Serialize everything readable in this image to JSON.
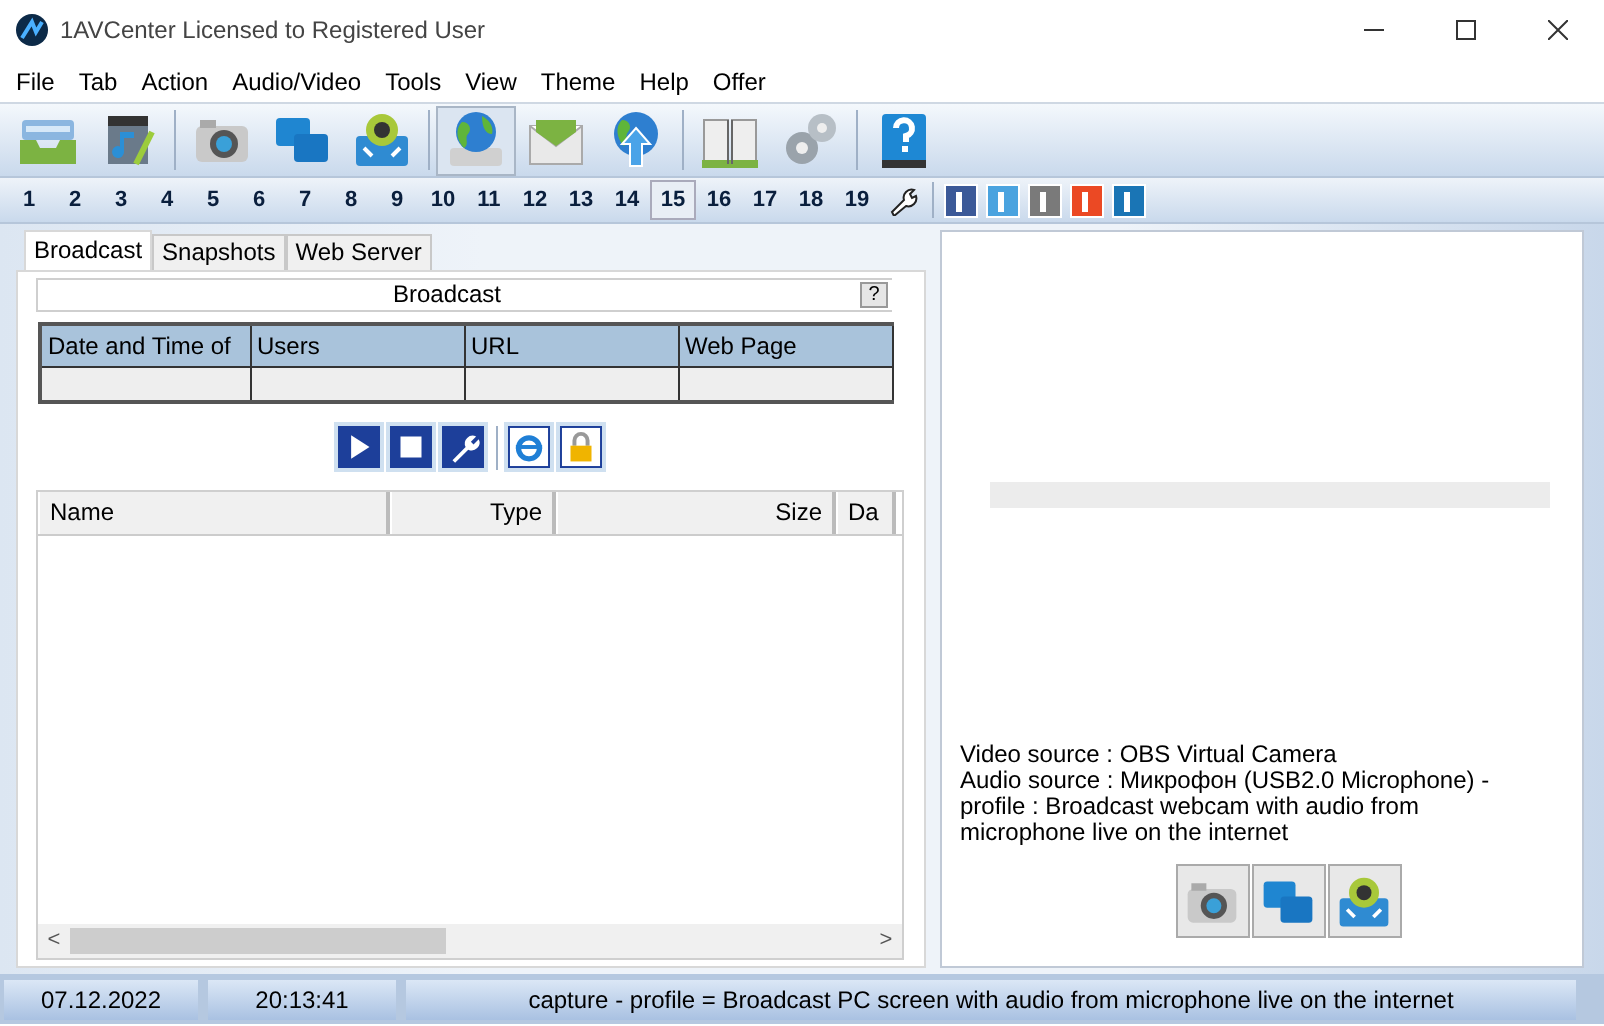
{
  "window": {
    "title": "1AVCenter Licensed to Registered User"
  },
  "menu": [
    "File",
    "Tab",
    "Action",
    "Audio/Video",
    "Tools",
    "View",
    "Theme",
    "Help",
    "Offer"
  ],
  "toolbar": [
    [
      {
        "kind": "inbox",
        "selected": false
      },
      {
        "kind": "media",
        "selected": false
      }
    ],
    [
      {
        "kind": "camera",
        "selected": false
      },
      {
        "kind": "screen",
        "selected": false
      },
      {
        "kind": "webcam",
        "selected": false
      }
    ],
    [
      {
        "kind": "drive",
        "selected": true
      },
      {
        "kind": "mail",
        "selected": false
      },
      {
        "kind": "upload",
        "selected": false
      }
    ],
    [
      {
        "kind": "book",
        "selected": false
      },
      {
        "kind": "gears",
        "selected": false
      }
    ],
    [
      {
        "kind": "help",
        "selected": false
      }
    ]
  ],
  "number_buttons": [
    {
      "label": "1",
      "selected": false
    },
    {
      "label": "2",
      "selected": false
    },
    {
      "label": "3",
      "selected": false
    },
    {
      "label": "4",
      "selected": false
    },
    {
      "label": "5",
      "selected": false
    },
    {
      "label": "6",
      "selected": false
    },
    {
      "label": "7",
      "selected": false
    },
    {
      "label": "8",
      "selected": false
    },
    {
      "label": "9",
      "selected": false
    },
    {
      "label": "10",
      "selected": false
    },
    {
      "label": "11",
      "selected": false
    },
    {
      "label": "12",
      "selected": false
    },
    {
      "label": "13",
      "selected": false
    },
    {
      "label": "14",
      "selected": false
    },
    {
      "label": "15",
      "selected": true
    },
    {
      "label": "16",
      "selected": false
    },
    {
      "label": "17",
      "selected": false
    },
    {
      "label": "18",
      "selected": false
    },
    {
      "label": "19",
      "selected": false
    }
  ],
  "social": [
    {
      "color": "#3b5998"
    },
    {
      "color": "#4aa3df"
    },
    {
      "color": "#7a7a7a"
    },
    {
      "color": "#eb4924"
    },
    {
      "color": "#1a75b5"
    }
  ],
  "tabs": [
    {
      "label": "Broadcast",
      "selected": true
    },
    {
      "label": "Snapshots",
      "selected": false
    },
    {
      "label": "Web Server",
      "selected": false
    }
  ],
  "broadcast": {
    "title": "Broadcast",
    "help": "?",
    "table": {
      "columns": [
        "Date and Time of",
        "Users",
        "URL",
        "Web Page"
      ]
    },
    "actions": [
      {
        "kind": "play"
      },
      {
        "kind": "stop"
      },
      {
        "kind": "wrench"
      },
      {
        "kind": "browser"
      },
      {
        "kind": "lock"
      }
    ]
  },
  "files": {
    "columns": [
      "Name",
      "Type",
      "Size",
      "Da"
    ],
    "scroll_left": "<",
    "scroll_right": ">"
  },
  "preview": {
    "progress": {
      "level": 0
    },
    "info": [
      "Video source : OBS Virtual Camera",
      "Audio source : Микрофон (USB2.0 Microphone) - profile : Broadcast webcam with audio from microphone live on the internet"
    ],
    "sources": [
      {
        "kind": "camera"
      },
      {
        "kind": "screen"
      },
      {
        "kind": "webcam"
      }
    ]
  },
  "status_bar": [
    "07.12.2022",
    "20:13:41",
    "capture - profile =  Broadcast PC screen with audio from microphone live on the internet"
  ]
}
